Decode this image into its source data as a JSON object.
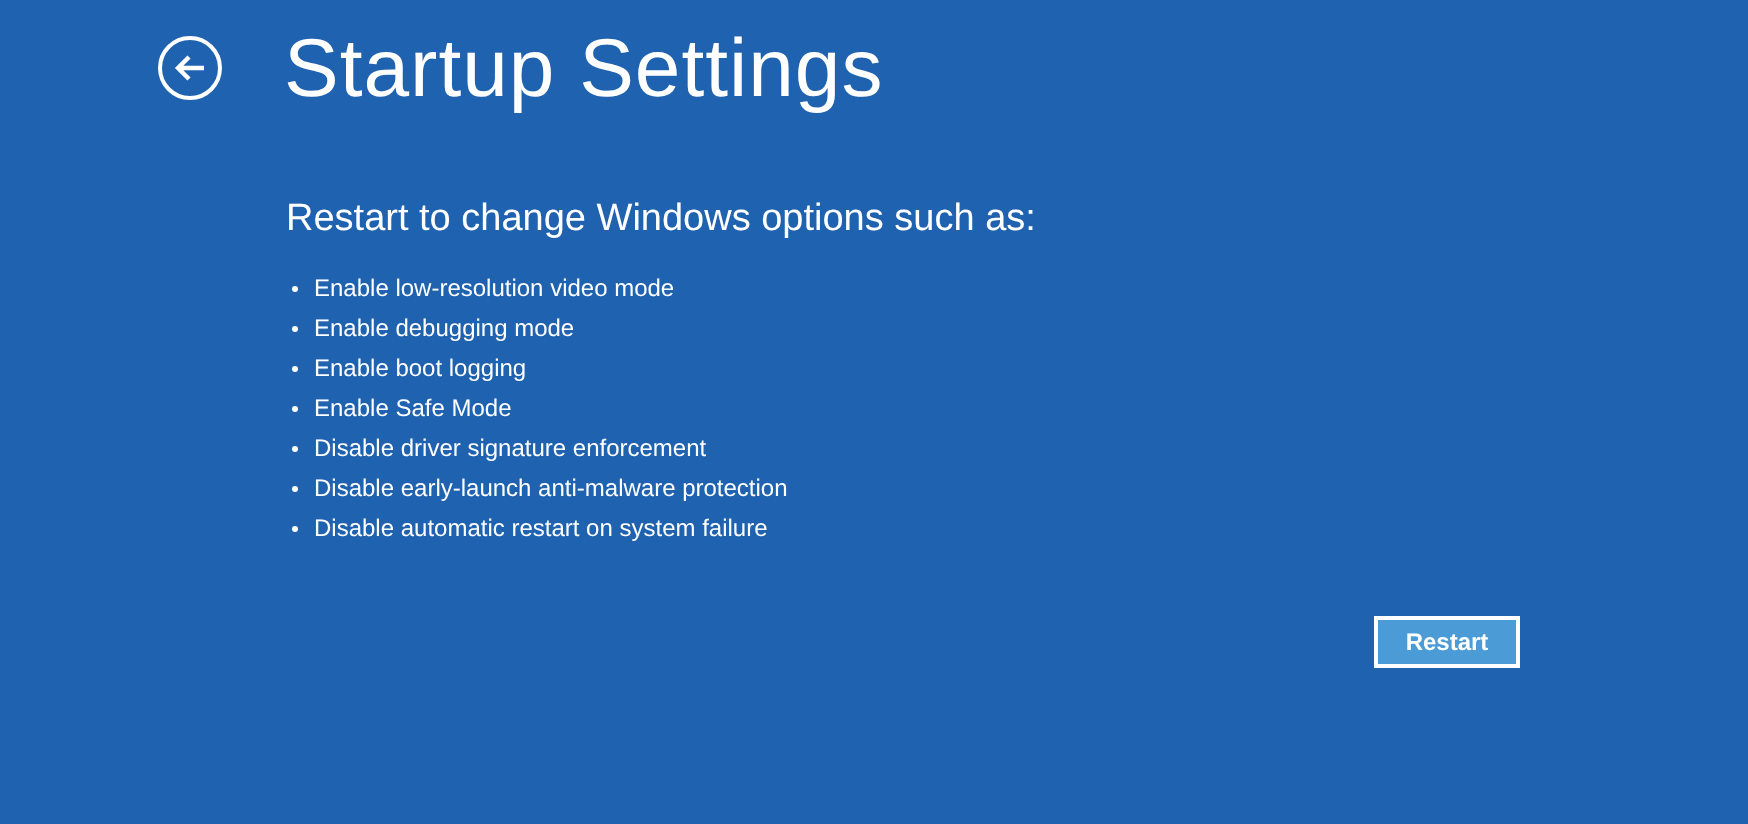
{
  "title": "Startup Settings",
  "subtitle": "Restart to change Windows options such as:",
  "options": [
    "Enable low-resolution video mode",
    "Enable debugging mode",
    "Enable boot logging",
    "Enable Safe Mode",
    "Disable driver signature enforcement",
    "Disable early-launch anti-malware protection",
    "Disable automatic restart on system failure"
  ],
  "button": "Restart"
}
